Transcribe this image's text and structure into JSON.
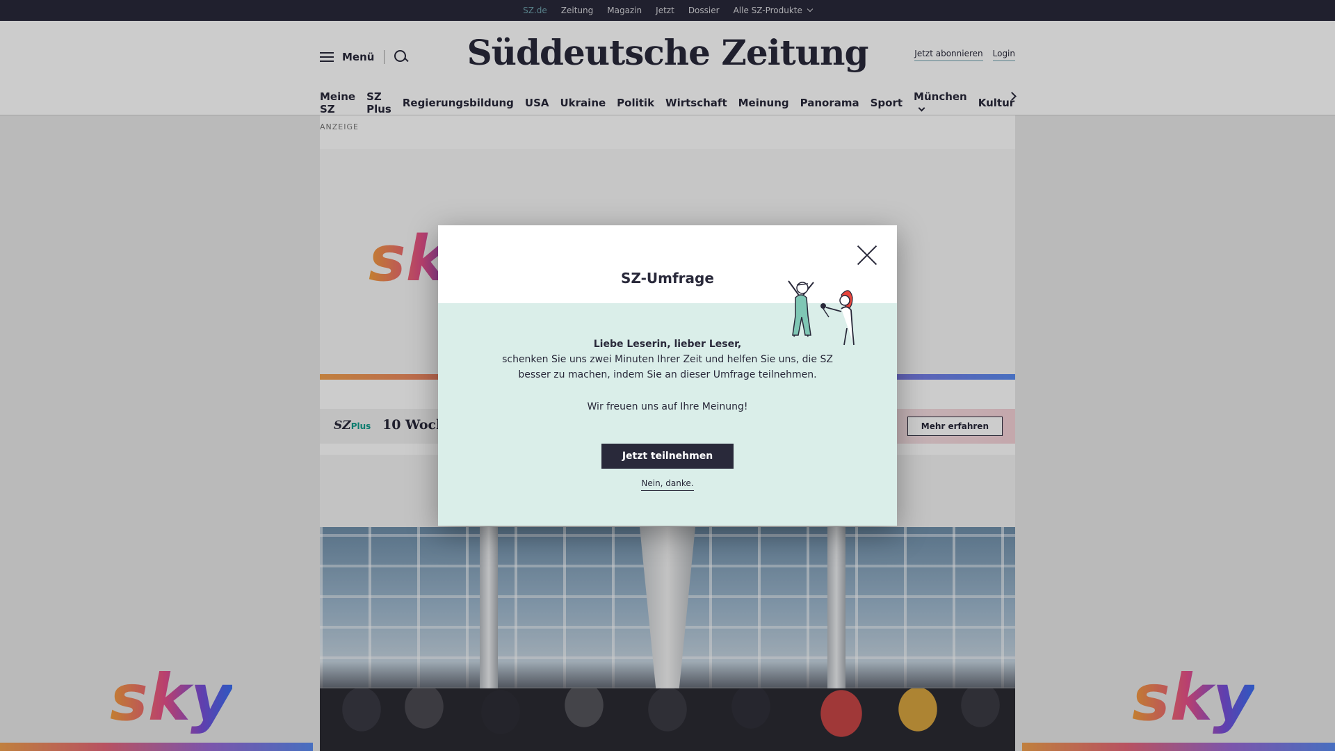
{
  "topbar": {
    "links": [
      {
        "label": "SZ.de",
        "active": true
      },
      {
        "label": "Zeitung"
      },
      {
        "label": "Magazin"
      },
      {
        "label": "Jetzt"
      },
      {
        "label": "Dossier"
      },
      {
        "label": "Alle SZ-Produkte"
      }
    ]
  },
  "header": {
    "menu_label": "Menü",
    "logo": "Süddeutsche Zeitung",
    "subscribe_label": "Jetzt abonnieren",
    "login_label": "Login"
  },
  "nav": {
    "items": [
      "Meine SZ",
      "SZ Plus",
      "Regierungsbildung",
      "USA",
      "Ukraine",
      "Politik",
      "Wirtschaft",
      "Meinung",
      "Panorama",
      "Sport",
      "München",
      "Kultur"
    ]
  },
  "ad": {
    "label": "ANZEIGE",
    "brand": "sky"
  },
  "promo": {
    "brand": "SZ",
    "brand_suffix": "Plus",
    "text": "10 Woch",
    "button_label": "Mehr erfahren"
  },
  "modal": {
    "title": "SZ-Umfrage",
    "greeting": "Liebe Leserin, lieber Leser,",
    "body_line1": "schenken Sie uns zwei Minuten Ihrer Zeit und helfen Sie uns, die SZ",
    "body_line2": "besser zu machen, indem Sie an dieser Umfrage teilnehmen.",
    "thanks": "Wir freuen uns auf Ihre Meinung!",
    "participate_label": "Jetzt teilnehmen",
    "decline_label": "Nein, danke."
  },
  "colors": {
    "brand_dark": "#29293a",
    "accent_teal": "#6fa2ad",
    "modal_bg": "#daeee9"
  }
}
